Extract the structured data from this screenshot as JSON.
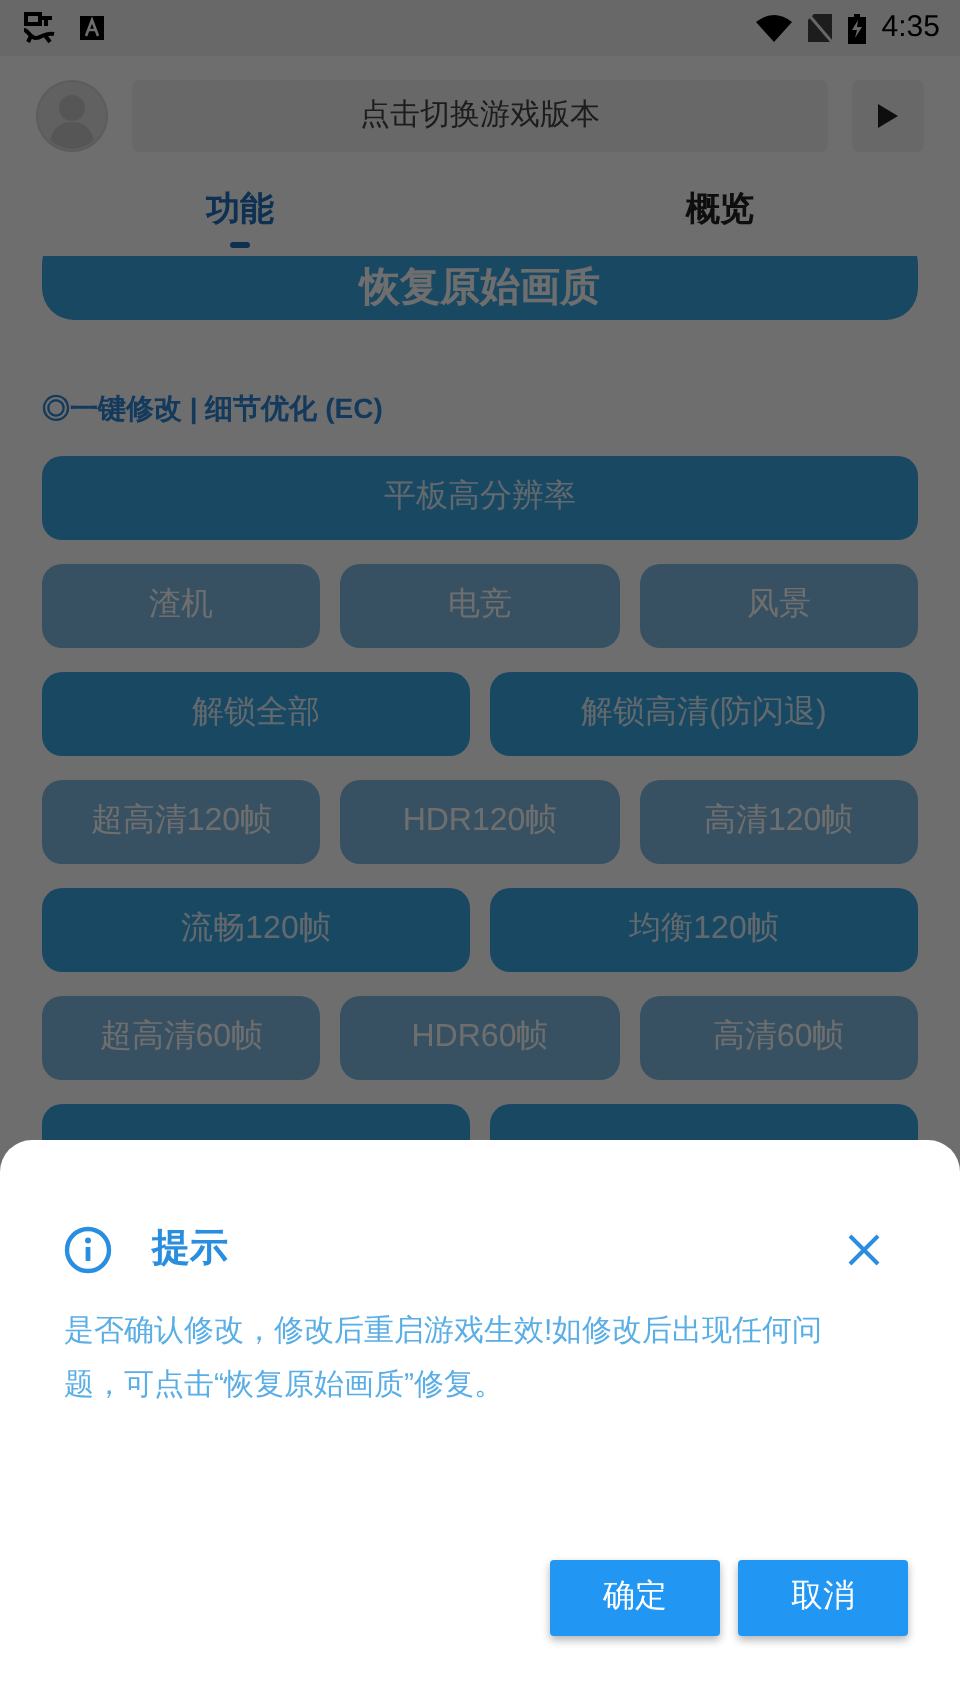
{
  "status_bar": {
    "time": "4:35"
  },
  "header": {
    "version_button": "点击切换游戏版本"
  },
  "tabs": [
    {
      "label": "功能",
      "selected": true
    },
    {
      "label": "概览",
      "selected": false
    }
  ],
  "restore_button": {
    "label": "恢复原始画质"
  },
  "section_title": "◎一键修改 | 细节优化 (EC)",
  "button_rows": [
    [
      {
        "label": "平板高分辨率",
        "disabled": false
      }
    ],
    [
      {
        "label": "渣机",
        "disabled": true
      },
      {
        "label": "电竞",
        "disabled": true
      },
      {
        "label": "风景",
        "disabled": true
      }
    ],
    [
      {
        "label": "解锁全部",
        "disabled": false
      },
      {
        "label": "解锁高清(防闪退)",
        "disabled": false
      }
    ],
    [
      {
        "label": "超高清120帧",
        "disabled": true
      },
      {
        "label": "HDR120帧",
        "disabled": true
      },
      {
        "label": "高清120帧",
        "disabled": true
      }
    ],
    [
      {
        "label": "流畅120帧",
        "disabled": false
      },
      {
        "label": "均衡120帧",
        "disabled": false
      }
    ],
    [
      {
        "label": "超高清60帧",
        "disabled": true
      },
      {
        "label": "HDR60帧",
        "disabled": true
      },
      {
        "label": "高清60帧",
        "disabled": true
      }
    ],
    [
      {
        "disabled": false
      },
      {
        "disabled": false
      }
    ]
  ],
  "dialog": {
    "title": "提示",
    "message": "是否确认修改，修改后重启游戏生效!如修改后出现任何问题，可点击“恢复原始画质”修复。",
    "buttons": [
      "确定",
      "取消"
    ]
  }
}
